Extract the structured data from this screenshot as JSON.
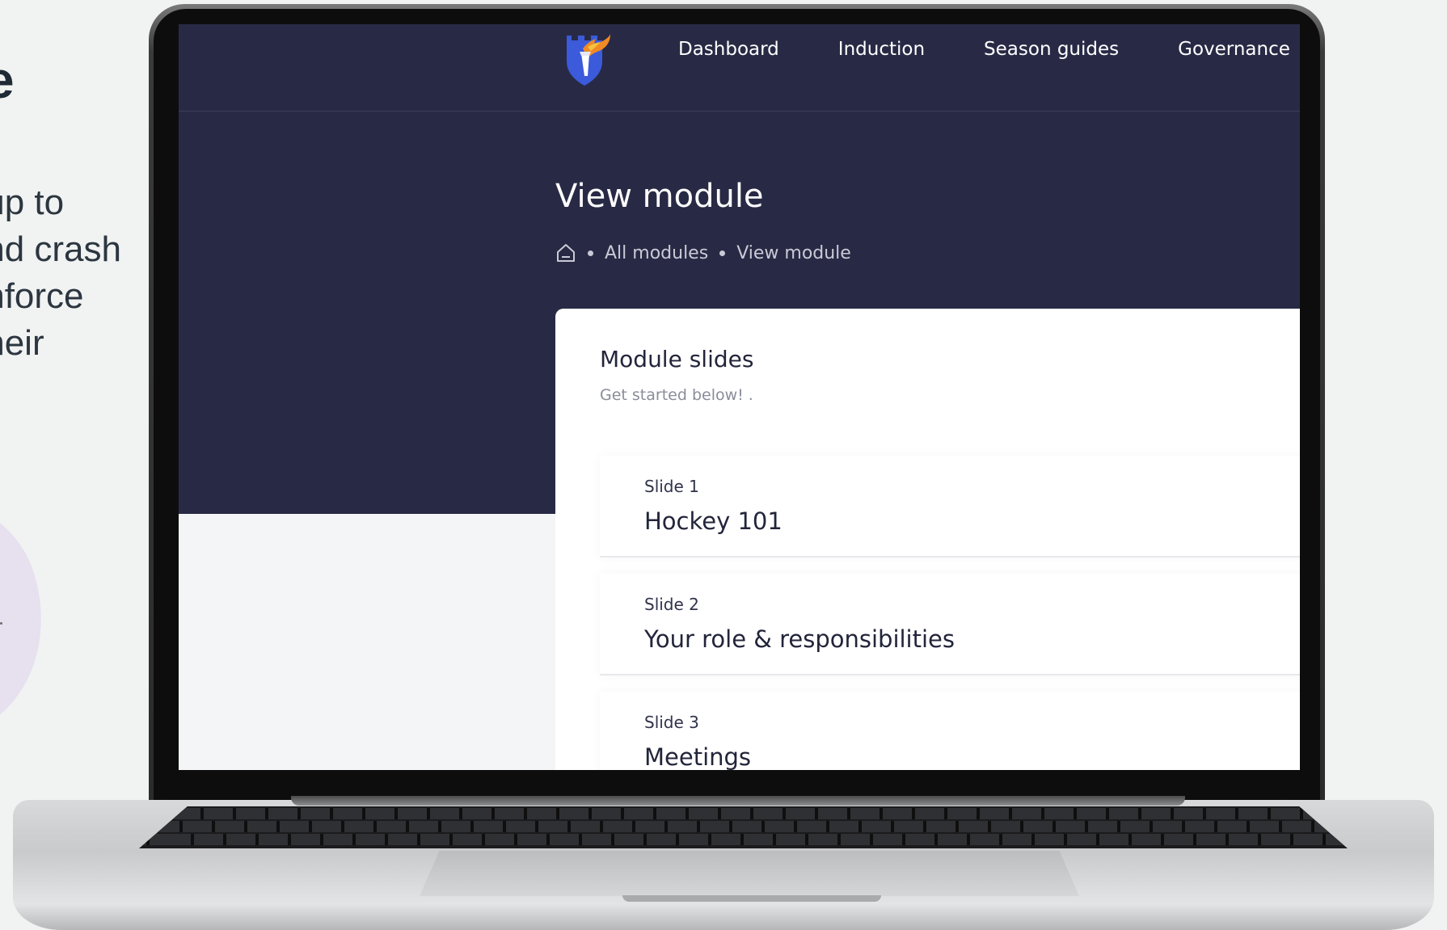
{
  "marketing": {
    "heading_fragment": "e",
    "paragraph_lines": [
      "up to",
      "nd crash",
      "nforce",
      "heir"
    ]
  },
  "app": {
    "nav": [
      {
        "label": "Dashboard"
      },
      {
        "label": "Induction"
      },
      {
        "label": "Season guides"
      },
      {
        "label": "Governance"
      }
    ],
    "page_title": "View module",
    "breadcrumb": {
      "home_icon": "home-icon",
      "items": [
        "All modules",
        "View module"
      ]
    },
    "card": {
      "title": "Module slides",
      "subtitle": "Get started below! .",
      "slides": [
        {
          "number": "Slide 1",
          "title": "Hockey 101"
        },
        {
          "number": "Slide 2",
          "title": "Your role & responsibilities"
        },
        {
          "number": "Slide 3",
          "title": "Meetings"
        }
      ]
    }
  },
  "colors": {
    "header_bg": "#282a45",
    "page_bg": "#f4f5f6",
    "logo_shield": "#3b5bdb",
    "logo_flame": "#f08a24"
  }
}
